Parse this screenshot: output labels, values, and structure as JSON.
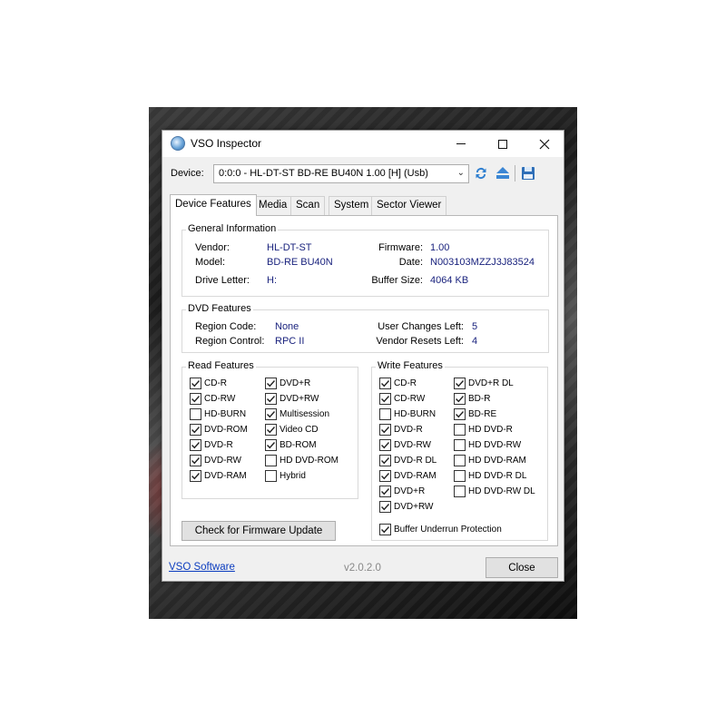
{
  "window": {
    "title": "VSO Inspector"
  },
  "device": {
    "label": "Device:",
    "value": "0:0:0 - HL-DT-ST BD-RE BU40N 1.00 [H] (Usb)"
  },
  "tabs": [
    {
      "label": "Device Features",
      "active": true
    },
    {
      "label": "Media",
      "active": false
    },
    {
      "label": "Scan",
      "active": false
    },
    {
      "label": "System",
      "active": false
    },
    {
      "label": "Sector Viewer",
      "active": false
    }
  ],
  "general": {
    "title": "General Information",
    "vendor_label": "Vendor:",
    "vendor": "HL-DT-ST",
    "model_label": "Model:",
    "model": "BD-RE BU40N",
    "drive_letter_label": "Drive Letter:",
    "drive_letter": "H:",
    "firmware_label": "Firmware:",
    "firmware": "1.00",
    "date_label": "Date:",
    "date": "N003103MZZJ3J83524",
    "buffer_label": "Buffer Size:",
    "buffer": "4064 KB"
  },
  "dvd": {
    "title": "DVD Features",
    "region_code_label": "Region Code:",
    "region_code": "None",
    "region_control_label": "Region Control:",
    "region_control": "RPC II",
    "user_changes_label": "User Changes Left:",
    "user_changes": "5",
    "vendor_resets_label": "Vendor Resets Left:",
    "vendor_resets": "4"
  },
  "read_features": {
    "title": "Read Features",
    "col1": [
      {
        "label": "CD-R",
        "checked": true
      },
      {
        "label": "CD-RW",
        "checked": true
      },
      {
        "label": "HD-BURN",
        "checked": false
      },
      {
        "label": "DVD-ROM",
        "checked": true
      },
      {
        "label": "DVD-R",
        "checked": true
      },
      {
        "label": "DVD-RW",
        "checked": true
      },
      {
        "label": "DVD-RAM",
        "checked": true
      }
    ],
    "col2": [
      {
        "label": "DVD+R",
        "checked": true
      },
      {
        "label": "DVD+RW",
        "checked": true
      },
      {
        "label": "Multisession",
        "checked": true
      },
      {
        "label": "Video CD",
        "checked": true
      },
      {
        "label": "BD-ROM",
        "checked": true
      },
      {
        "label": "HD DVD-ROM",
        "checked": false
      },
      {
        "label": "Hybrid",
        "checked": false
      }
    ]
  },
  "write_features": {
    "title": "Write Features",
    "col1": [
      {
        "label": "CD-R",
        "checked": true
      },
      {
        "label": "CD-RW",
        "checked": true
      },
      {
        "label": "HD-BURN",
        "checked": false
      },
      {
        "label": "DVD-R",
        "checked": true
      },
      {
        "label": "DVD-RW",
        "checked": true
      },
      {
        "label": "DVD-R DL",
        "checked": true
      },
      {
        "label": "DVD-RAM",
        "checked": true
      },
      {
        "label": "DVD+R",
        "checked": true
      },
      {
        "label": "DVD+RW",
        "checked": true
      }
    ],
    "col2": [
      {
        "label": "DVD+R DL",
        "checked": true
      },
      {
        "label": "BD-R",
        "checked": true
      },
      {
        "label": "BD-RE",
        "checked": true
      },
      {
        "label": "HD DVD-R",
        "checked": false
      },
      {
        "label": "HD DVD-RW",
        "checked": false
      },
      {
        "label": "HD DVD-RAM",
        "checked": false
      },
      {
        "label": "HD DVD-R DL",
        "checked": false
      },
      {
        "label": "HD DVD-RW DL",
        "checked": false
      }
    ],
    "buffer_underrun": {
      "label": "Buffer Underrun Protection",
      "checked": true
    }
  },
  "buttons": {
    "firmware_update": "Check for Firmware Update",
    "close": "Close"
  },
  "footer": {
    "link": "VSO Software",
    "version": "v2.0.2.0"
  },
  "colors": {
    "value_text": "#1a237e",
    "link": "#0b3cbf"
  }
}
